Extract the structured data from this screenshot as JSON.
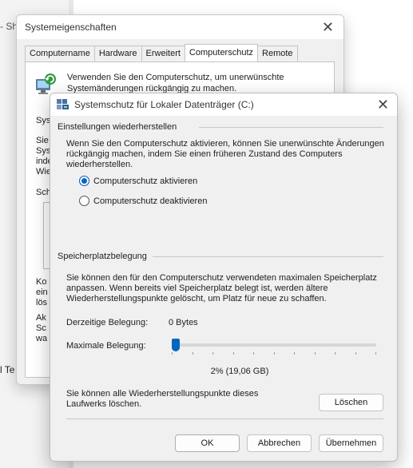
{
  "background": {
    "left_text_top": "- Sh",
    "left_text_bottom": "l Te"
  },
  "back_dialog": {
    "title": "Systemeigenschaften",
    "tabs": [
      "Computername",
      "Hardware",
      "Erweitert",
      "Computerschutz",
      "Remote"
    ],
    "active_tab": "Computerschutz",
    "description": "Verwenden Sie den Computerschutz, um unerwünschte Systemänderungen rückgängig zu machen.",
    "clipped_1": "Syst",
    "clipped_2": "Sie\nSys\ninde\nWie",
    "clipped_3": "Schu",
    "clipped_4": "Ko\nein\nlös",
    "clipped_5": "Ak\nSc\nwa"
  },
  "front_dialog": {
    "title": "Systemschutz für Lokaler Datenträger (C:)",
    "restore_section": {
      "heading": "Einstellungen wiederherstellen",
      "description": "Wenn Sie den Computerschutz aktivieren, können Sie unerwünschte Änderungen rückgängig machen, indem Sie einen früheren Zustand des Computers wiederherstellen.",
      "options": [
        {
          "label": "Computerschutz aktivieren",
          "checked": true
        },
        {
          "label": "Computerschutz deaktivieren",
          "checked": false
        }
      ]
    },
    "storage_section": {
      "heading": "Speicherplatzbelegung",
      "description": "Sie können den für den Computerschutz verwendeten maximalen Speicherplatz anpassen. Wenn bereits viel Speicherplatz belegt ist, werden ältere Wiederherstellungspunkte gelöscht, um Platz für neue zu schaffen.",
      "current_usage_label": "Derzeitige Belegung:",
      "current_usage_value": "0 Bytes",
      "max_usage_label": "Maximale Belegung:",
      "slider_fraction": 0.02,
      "slider_value_label": "2% (19,06 GB)",
      "delete_text": "Sie können alle Wiederherstellungspunkte dieses Laufwerks löschen.",
      "delete_button": "Löschen"
    },
    "buttons": {
      "ok": "OK",
      "cancel": "Abbrechen",
      "apply": "Übernehmen"
    }
  },
  "colors": {
    "accent": "#0067c0",
    "dialog_bg": "#f0f0f0"
  },
  "icons": {
    "close": "close-icon",
    "shield_computer": "system-protection-icon"
  }
}
